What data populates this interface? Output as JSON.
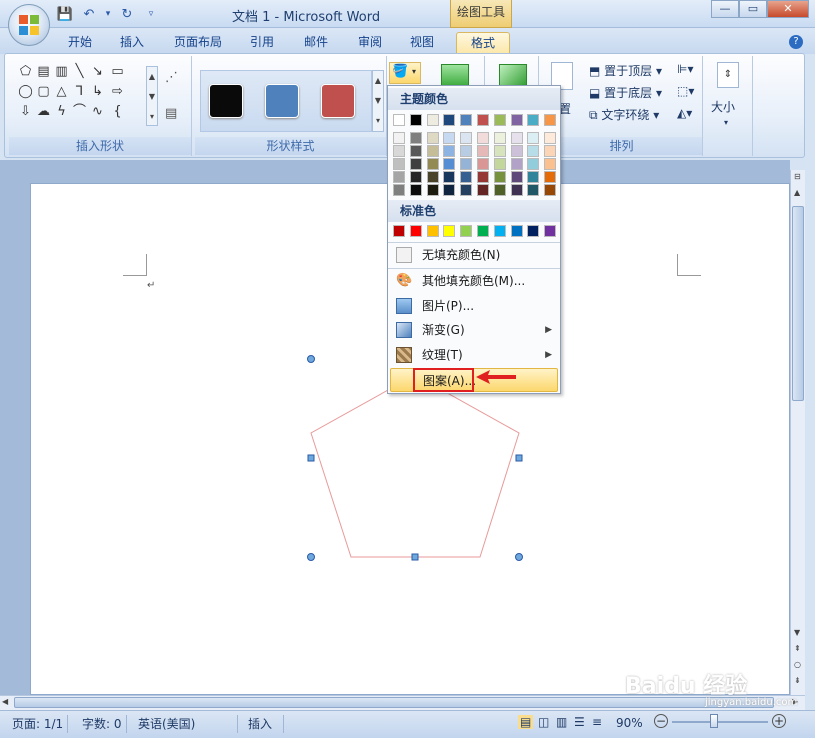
{
  "window": {
    "title": "文档 1 - Microsoft Word",
    "tool_context": "绘图工具",
    "min": "—",
    "max": "▭",
    "close": "✕"
  },
  "tabs": [
    {
      "label": "开始"
    },
    {
      "label": "插入"
    },
    {
      "label": "页面布局"
    },
    {
      "label": "引用"
    },
    {
      "label": "邮件"
    },
    {
      "label": "审阅"
    },
    {
      "label": "视图"
    },
    {
      "label": "格式",
      "active": true
    }
  ],
  "help": "?",
  "ribbon": {
    "insert_shapes_label": "插入形状",
    "shape_styles_label": "形状样式",
    "arrange_label": "排列",
    "size_label": "大小",
    "position_label": "置",
    "bring_front": "置于顶层",
    "send_back": "置于底层",
    "text_wrap": "文字环绕",
    "style_colors": [
      "#0a0a0a",
      "#4f81bd",
      "#c0504d"
    ]
  },
  "dropdown": {
    "theme_colors_header": "主题颜色",
    "standard_colors_header": "标准色",
    "theme_top": [
      "#ffffff",
      "#000000",
      "#eeece1",
      "#1f497d",
      "#4f81bd",
      "#c0504d",
      "#9bbb59",
      "#8064a2",
      "#4bacc6",
      "#f79646"
    ],
    "theme_shades": [
      [
        "#f2f2f2",
        "#7f7f7f",
        "#ddd9c3",
        "#c6d9f0",
        "#dbe5f1",
        "#f2dcdb",
        "#ebf1dd",
        "#e5e0ec",
        "#dbeef3",
        "#fdeada"
      ],
      [
        "#d8d8d8",
        "#595959",
        "#c4bd97",
        "#8db3e2",
        "#b8cce4",
        "#e5b9b7",
        "#d7e3bc",
        "#ccc1d9",
        "#b7dde8",
        "#fbd5b5"
      ],
      [
        "#bfbfbf",
        "#3f3f3f",
        "#938953",
        "#548dd4",
        "#95b3d7",
        "#d99694",
        "#c3d69b",
        "#b2a2c7",
        "#92cddc",
        "#fac08f"
      ],
      [
        "#a5a5a5",
        "#262626",
        "#494429",
        "#17365d",
        "#366092",
        "#953734",
        "#76923c",
        "#5f497a",
        "#31859b",
        "#e36c09"
      ],
      [
        "#7f7f7f",
        "#0c0c0c",
        "#1d1b10",
        "#0f243e",
        "#244061",
        "#632423",
        "#4f6128",
        "#3f3151",
        "#205867",
        "#974806"
      ]
    ],
    "standard": [
      "#c00000",
      "#ff0000",
      "#ffc000",
      "#ffff00",
      "#92d050",
      "#00b050",
      "#00b0f0",
      "#0070c0",
      "#002060",
      "#7030a0"
    ],
    "items": [
      {
        "label": "无填充颜色(N)",
        "icon": "no-fill-icon"
      },
      {
        "label": "其他填充颜色(M)...",
        "icon": "palette-icon"
      },
      {
        "label": "图片(P)...",
        "icon": "picture-icon"
      },
      {
        "label": "渐变(G)",
        "icon": "gradient-icon",
        "submenu": true
      },
      {
        "label": "纹理(T)",
        "icon": "texture-icon",
        "submenu": true
      },
      {
        "label": "图案(A)...",
        "icon": "pattern-icon",
        "highlighted": true
      }
    ]
  },
  "document": {
    "paragraph_mark": "↵"
  },
  "statusbar": {
    "page": "页面: 1/1",
    "words": "字数: 0",
    "language": "英语(美国)",
    "mode": "插入",
    "zoom": "90%"
  },
  "watermark": {
    "logo": "Baidu 经验",
    "url": "jingyan.baidu.com"
  }
}
